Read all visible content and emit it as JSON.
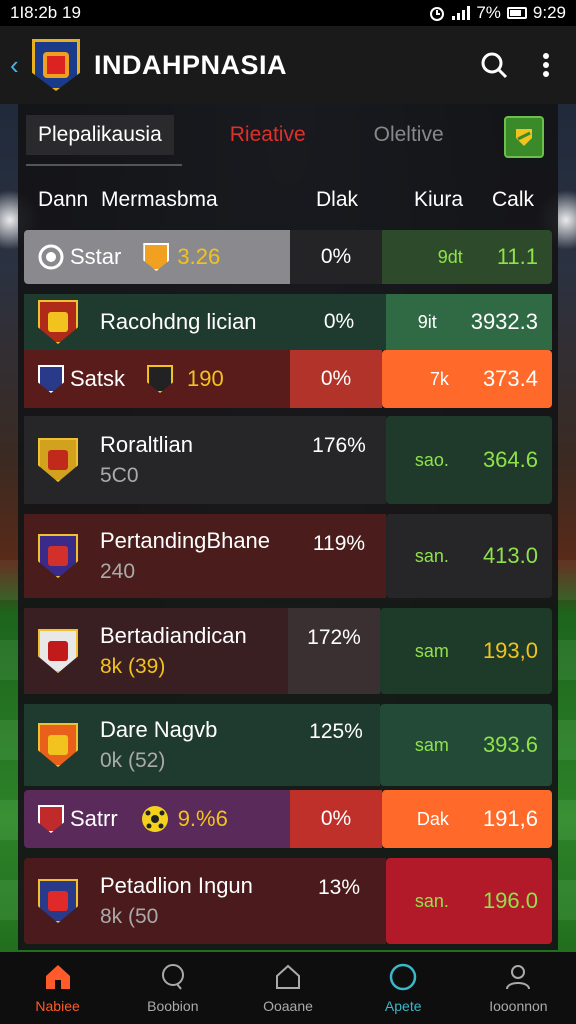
{
  "status_bar": {
    "time_left": "1I8:2b 19",
    "battery_pct": "7%",
    "time_right": "9:29"
  },
  "app_bar": {
    "title": "INDAHPNASIA"
  },
  "tabs": [
    {
      "label": "Plepalikausia",
      "active": true
    },
    {
      "label": "Rieative",
      "active": false
    },
    {
      "label": "Oleltive",
      "active": false
    }
  ],
  "columns": {
    "c1": "Dann",
    "c2": "Mermasbma",
    "c3": "Dlak",
    "c4": "Kiura",
    "c5": "Calk"
  },
  "rows": [
    {
      "kind": "compact",
      "name": "Sstar",
      "extra": "3.26",
      "pct": "0%",
      "label": "9dt",
      "value": "11.1",
      "left_bg": "#8a8a8e",
      "mid_bg": "#242426",
      "right_bg": "#2d4a2a",
      "value_color": "#8fe24a"
    },
    {
      "kind": "single",
      "name": "Racohdng lician",
      "pct": "0%",
      "label": "9it",
      "value": "3932.3",
      "left_bg": "#1f3a2e",
      "mid_bg": "#1f3a2e",
      "right_bg": "#2f6a44",
      "value_color": "#ffffff"
    },
    {
      "kind": "compact",
      "name": "Satsk",
      "extra": "190",
      "pct": "0%",
      "label": "7k",
      "value": "373.4",
      "left_bg": "#5a1c1a",
      "mid_bg": "#b2332a",
      "right_bg": "#ff6a2a",
      "value_color": "#ffffff"
    },
    {
      "kind": "double",
      "name": "Roraltlian",
      "sub": "5C0",
      "pct": "176%",
      "label": "sao.",
      "value": "364.6",
      "left_bg": "#262628",
      "mid_bg": "#262628",
      "right_bg": "#1f3a2a",
      "value_color": "#8fe24a"
    },
    {
      "kind": "double",
      "name": "PertandingBhane",
      "sub": "240",
      "pct": "119%",
      "label": "san.",
      "value": "413.0",
      "left_bg": "#4a1d1c",
      "mid_bg": "#4a1d1c",
      "right_bg": "#262628",
      "value_color": "#8fe24a"
    },
    {
      "kind": "double",
      "name": "Bertadiandican",
      "sub": "8k (39)",
      "pct": "172%",
      "label": "sam",
      "value": "193,0",
      "left_bg": "#3a1f22",
      "mid_bg": "#3a3032",
      "right_bg": "#1e3a28",
      "value_color": "#f2c21e"
    },
    {
      "kind": "double",
      "name": "Dare Nagvb",
      "sub": "0k (52)",
      "pct": "125%",
      "label": "sam",
      "value": "393.6",
      "left_bg": "#1f3a2e",
      "mid_bg": "#1f3a2e",
      "right_bg": "#234a36",
      "value_color": "#8fe24a"
    },
    {
      "kind": "compact",
      "name": "Satrr",
      "extra": "9.%6",
      "pct": "0%",
      "label": "Dak",
      "value": "191,6",
      "left_bg": "#5a2a5a",
      "mid_bg": "#c0302a",
      "right_bg": "#ff6a2a",
      "value_color": "#ffffff"
    },
    {
      "kind": "double",
      "name": "Petadlion Ingun",
      "sub": "8k (50",
      "pct": "13%",
      "label": "san.",
      "value": "196.0",
      "left_bg": "#4a1a1c",
      "mid_bg": "#4a1a1c",
      "right_bg": "#b21a2a",
      "value_color": "#8fe24a"
    }
  ],
  "bottom_nav": [
    {
      "label": "Nabiee",
      "active": true
    },
    {
      "label": "Boobion",
      "active": false
    },
    {
      "label": "Ooaane",
      "active": false
    },
    {
      "label": "Apete",
      "active": false
    },
    {
      "label": "Iooonnon",
      "active": false
    }
  ]
}
